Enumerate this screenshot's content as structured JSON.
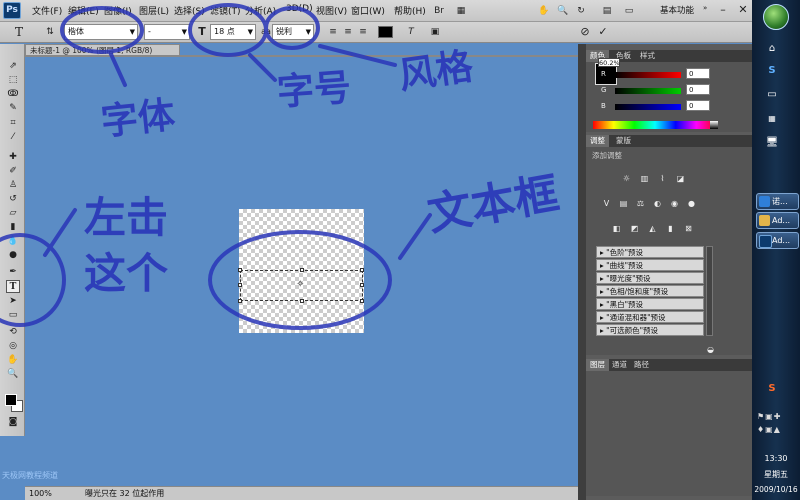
{
  "menubar": {
    "logo": "Ps",
    "items": [
      "文件(F)",
      "编辑(E)",
      "图像(I)",
      "图层(L)",
      "选择(S)",
      "滤镜(T)",
      "分析(A)",
      "3D(D)",
      "视图(V)",
      "窗口(W)",
      "帮助(H)"
    ],
    "workspace": "基本功能"
  },
  "options": {
    "font_family": "楷体",
    "font_style": "-",
    "font_size": "18 点",
    "aa": "锐利"
  },
  "document": {
    "tab_title": "未标题-1 @ 100% (图层 1, RGB/8)"
  },
  "status": {
    "zoom": "100%",
    "message": "曝光只在 32 位起作用"
  },
  "color_panel": {
    "tabs": [
      "颜色",
      "色板",
      "样式"
    ],
    "zoom_tip": "60.2%",
    "r": "0",
    "g": "0",
    "b": "0"
  },
  "adjust_panel": {
    "tabs": [
      "调整",
      "蒙版"
    ],
    "heading": "添加调整",
    "presets": [
      "\"色阶\"预设",
      "\"曲线\"预设",
      "\"曝光度\"预设",
      "\"色相/饱和度\"预设",
      "\"黑白\"预设",
      "\"通道混和器\"预设",
      "\"可选颜色\"预设"
    ]
  },
  "layers_panel": {
    "tabs": [
      "图层",
      "通道",
      "路径"
    ]
  },
  "taskbar": {
    "items": [
      "诺...",
      "Ad...",
      "Ad..."
    ],
    "time": "13:30",
    "weekday": "星期五",
    "date": "2009/10/16"
  },
  "annotations": {
    "font": "字体",
    "size": "字号",
    "style": "风格",
    "click_this": "左击这个",
    "textbox": "文本框"
  },
  "watermark": "天极网教程频道",
  "colors": {
    "workspace": "#5b8cc5",
    "annotation": "#2a36b8",
    "panel_bg": "#545454"
  }
}
